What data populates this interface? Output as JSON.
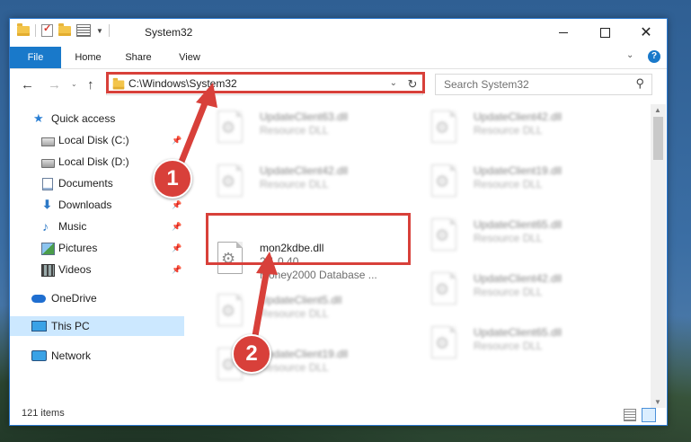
{
  "window": {
    "title": "System32",
    "minimize_icon": "minimize-icon",
    "maximize_icon": "maximize-icon",
    "close_icon": "close-icon"
  },
  "ribbon": {
    "tabs": [
      {
        "label": "File",
        "active": true
      },
      {
        "label": "Home"
      },
      {
        "label": "Share"
      },
      {
        "label": "View"
      }
    ],
    "help_label": "?"
  },
  "nav": {
    "address": "C:\\Windows\\System32",
    "search_placeholder": "Search System32"
  },
  "sidebar": {
    "items": [
      {
        "label": "Quick access",
        "icon": "star-icon"
      },
      {
        "label": "Local Disk (C:)",
        "icon": "disk-icon",
        "pinned": true
      },
      {
        "label": "Local Disk (D:)",
        "icon": "disk-icon"
      },
      {
        "label": "Documents",
        "icon": "documents-icon",
        "pinned": true
      },
      {
        "label": "Downloads",
        "icon": "download-icon",
        "pinned": true
      },
      {
        "label": "Music",
        "icon": "music-icon",
        "pinned": true
      },
      {
        "label": "Pictures",
        "icon": "pictures-icon",
        "pinned": true
      },
      {
        "label": "Videos",
        "icon": "videos-icon",
        "pinned": true
      },
      {
        "label": "OneDrive",
        "icon": "cloud-icon"
      },
      {
        "label": "This PC",
        "icon": "computer-icon",
        "selected": true
      },
      {
        "label": "Network",
        "icon": "network-icon"
      }
    ]
  },
  "files": {
    "left": [
      {
        "name": "UpdateClient63.dll",
        "desc": "Resource DLL"
      },
      {
        "name": "UpdateClient42.dll",
        "desc": "Resource DLL"
      },
      {
        "name": "UpdateClient5.dll",
        "desc": "Resource DLL"
      },
      {
        "name": "UpdateClient19.dll",
        "desc": "Resource DLL"
      }
    ],
    "right": [
      {
        "name": "UpdateClient42.dll",
        "desc": "Resource DLL"
      },
      {
        "name": "UpdateClient19.dll",
        "desc": "Resource DLL"
      },
      {
        "name": "UpdateClient65.dll",
        "desc": "Resource DLL"
      },
      {
        "name": "UpdateClient42.dll",
        "desc": "Resource DLL"
      },
      {
        "name": "UpdateClient65.dll",
        "desc": "Resource DLL"
      }
    ],
    "highlighted": {
      "name": "mon2kdbe.dll",
      "version": "2.1.0.40",
      "desc": "Money2000 Database ..."
    }
  },
  "status": {
    "count": "121 items"
  },
  "callouts": {
    "one": "1",
    "two": "2"
  },
  "colors": {
    "accent": "#1979ca",
    "highlight": "#d8403a",
    "selected": "#cce8ff"
  }
}
